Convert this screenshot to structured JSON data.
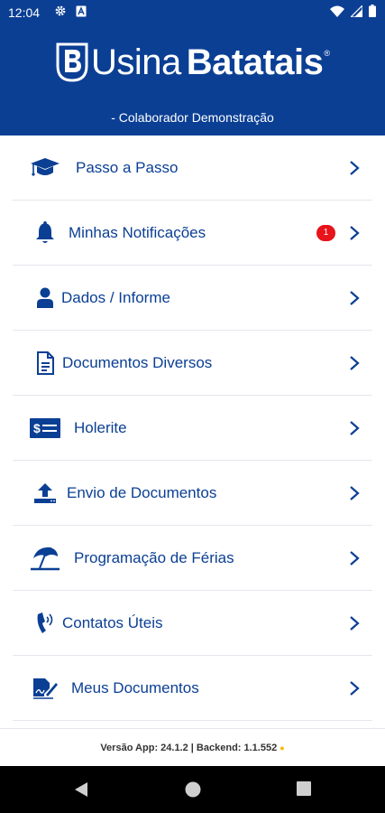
{
  "status_bar": {
    "time": "12:04",
    "left_icons": [
      "gear-icon",
      "a-box-icon"
    ],
    "right_icons": [
      "wifi-icon",
      "signal-icon",
      "battery-icon"
    ]
  },
  "header": {
    "brand_regular": "Usina",
    "brand_bold": "Batatais",
    "registered_mark": "®",
    "subtitle": "- Colaborador Demonstração",
    "background_color": "#0b3f94"
  },
  "menu": {
    "items": [
      {
        "label": "Passo a Passo",
        "icon": "graduation-cap-icon"
      },
      {
        "label": "Minhas Notificações",
        "icon": "bell-icon",
        "badge": "1"
      },
      {
        "label": "Dados / Informe",
        "icon": "user-icon"
      },
      {
        "label": "Documentos Diversos",
        "icon": "document-icon"
      },
      {
        "label": "Holerite",
        "icon": "money-check-icon"
      },
      {
        "label": "Envio de Documentos",
        "icon": "upload-icon"
      },
      {
        "label": "Programação de Férias",
        "icon": "beach-umbrella-icon"
      },
      {
        "label": "Contatos Úteis",
        "icon": "phone-icon"
      },
      {
        "label": "Meus Documentos",
        "icon": "signature-icon"
      }
    ]
  },
  "footer": {
    "version_text": "Versão App: 24.1.2 | Backend: 1.1.552",
    "status_dot": "●",
    "status_color": "#f5b800"
  },
  "nav_bar": {
    "buttons": [
      "back-icon",
      "home-icon",
      "recents-icon"
    ]
  },
  "colors": {
    "brand_blue": "#0b3f94",
    "badge_red": "#e8131b"
  }
}
